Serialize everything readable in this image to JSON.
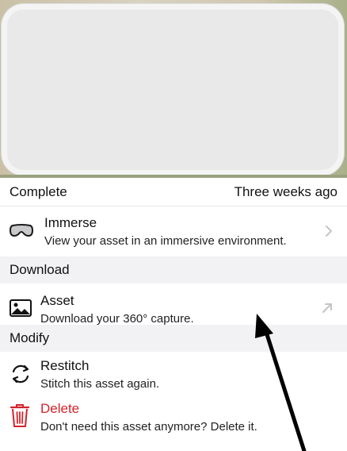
{
  "status": {
    "state": "Complete",
    "age": "Three weeks ago"
  },
  "immerse": {
    "title": "Immerse",
    "subtitle": "View your asset in an immersive environment."
  },
  "sections": {
    "download": "Download",
    "modify": "Modify"
  },
  "asset": {
    "title": "Asset",
    "subtitle": "Download your 360° capture."
  },
  "restitch": {
    "title": "Restitch",
    "subtitle": "Stitch this asset again."
  },
  "delete": {
    "title": "Delete",
    "subtitle": "Don't need this asset anymore? Delete it."
  },
  "colors": {
    "destructive": "#d4242c",
    "section_bg": "#f2f2f4",
    "chevron": "#c4c4c6"
  },
  "icons": {
    "immerse": "vr-headset-icon",
    "immerse_accessory": "chevron-right-icon",
    "asset": "photo-icon",
    "asset_accessory": "external-arrow-icon",
    "restitch": "refresh-icon",
    "delete": "trash-icon"
  }
}
